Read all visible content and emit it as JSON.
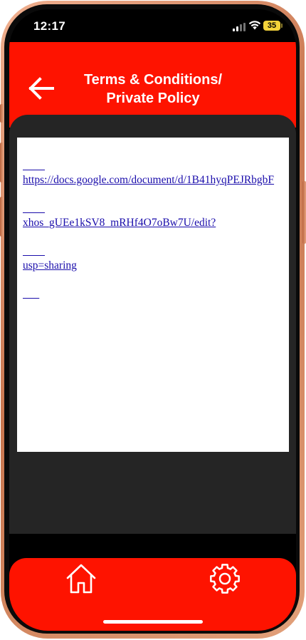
{
  "status_bar": {
    "time": "12:17",
    "battery": "35"
  },
  "header": {
    "title_line1": "Terms & Conditions/",
    "title_line2": "Private Policy"
  },
  "document": {
    "link_line1": "https://docs.google.com/document/d/1B41hyqPEJRbgbF",
    "link_line2": "xhos_gUEe1kSV8_mRHf4O7oBw7U/edit?",
    "link_line3": "usp=sharing"
  },
  "bottom_nav": {
    "items": [
      "home-icon",
      "settings-icon"
    ]
  },
  "colors": {
    "accent": "#fe1300",
    "panel": "#252525",
    "link": "#1a0dab"
  }
}
